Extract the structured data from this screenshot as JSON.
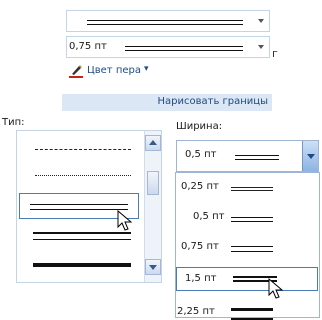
{
  "ribbon": {
    "width_value": "0,75 пт",
    "pen_color_label": "Цвет пера",
    "pen_color_dropdown": "▾",
    "group_label": "Нарисовать границы",
    "cut_char": "г"
  },
  "type_panel": {
    "label": "Тип:",
    "selected_index": 2,
    "styles": [
      "dash-dot",
      "dashed",
      "double",
      "thick-thin",
      "thick"
    ]
  },
  "width_panel": {
    "label": "Ширина:",
    "current_value": "0,5 пт",
    "options": [
      "0,25 пт",
      "0,5 пт",
      "0,75 пт",
      "1,5 пт",
      "2,25 пт"
    ],
    "highlighted": "1,5 пт"
  },
  "colors": {
    "accent": "#4a7ab8",
    "highlight_bg": "#ffffff",
    "group_bar": "#dbe7f5",
    "dropdown_btn": "#9ebbe3"
  }
}
